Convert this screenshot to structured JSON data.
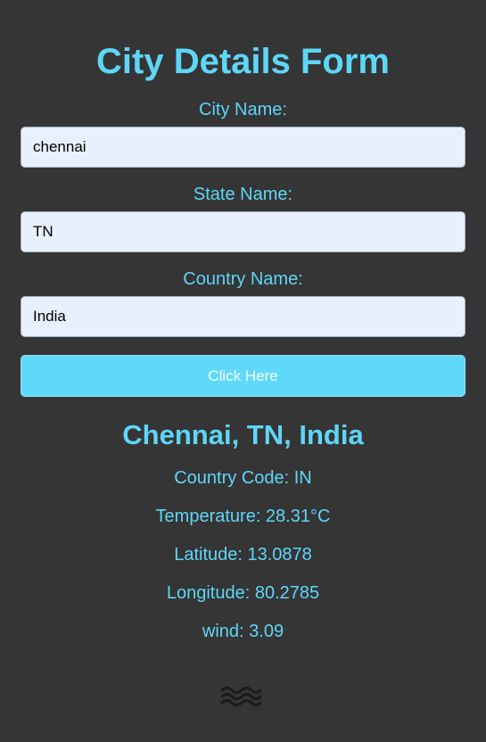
{
  "form": {
    "title": "City Details Form",
    "city_label": "City Name:",
    "city_value": "chennai",
    "state_label": "State Name:",
    "state_value": "TN",
    "country_label": "Country Name:",
    "country_value": "India",
    "submit_label": "Click Here"
  },
  "result": {
    "heading": "Chennai, TN, India",
    "country_code": "Country Code: IN",
    "temperature": "Temperature: 28.31°C",
    "latitude": "Latitude: 13.0878",
    "longitude": "Longitude: 80.2785",
    "wind": "wind: 3.09",
    "icon": "haze-icon"
  },
  "colors": {
    "background": "#353535",
    "accent": "#5ed6f8",
    "input_background": "#e8f0fe",
    "button_background": "#5fd9fa"
  }
}
